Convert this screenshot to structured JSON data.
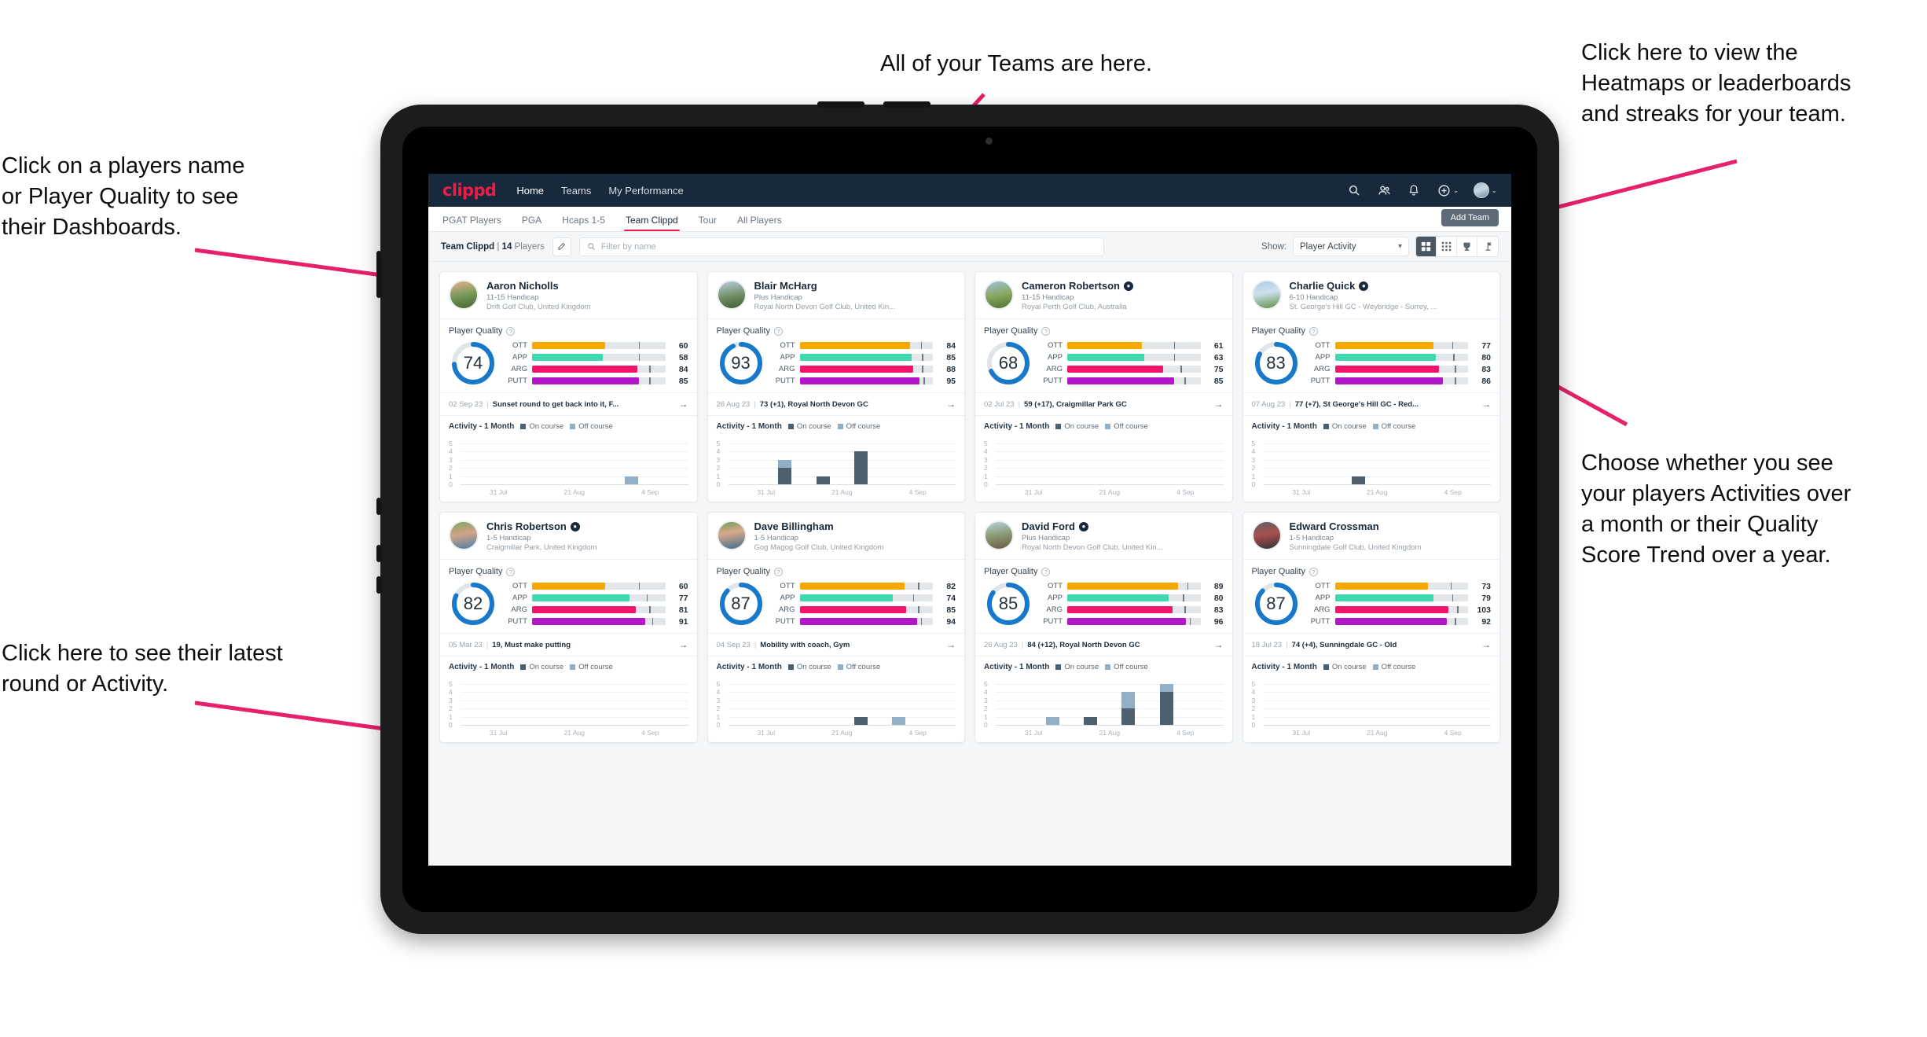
{
  "annotations": {
    "players": "Click on a players name\nor Player Quality to see\ntheir Dashboards.",
    "latest": "Click here to see their latest\nround or Activity.",
    "teams": "All of your Teams are here.",
    "heatmaps": "Click here to view the\nHeatmaps or leaderboards\nand streaks for your team.",
    "choose": "Choose whether you see\nyour players Activities over\na month or their Quality\nScore Trend over a year."
  },
  "topnav": {
    "logo": "clippd",
    "links": [
      {
        "label": "Home",
        "active": true
      },
      {
        "label": "Teams",
        "active": false
      },
      {
        "label": "My Performance",
        "active": false
      }
    ],
    "icons": [
      "search-icon",
      "people-icon",
      "bell-icon",
      "plus-circle-icon"
    ],
    "add_caret": "⌄",
    "avatar_caret": "⌄"
  },
  "subnav": {
    "tabs": [
      {
        "label": "PGAT Players",
        "active": false
      },
      {
        "label": "PGA",
        "active": false
      },
      {
        "label": "Hcaps 1-5",
        "active": false
      },
      {
        "label": "Team Clippd",
        "active": true
      },
      {
        "label": "Tour",
        "active": false
      },
      {
        "label": "All Players",
        "active": false
      }
    ],
    "add_team_label": "Add Team"
  },
  "toolbar": {
    "team_name": "Team Clippd",
    "separator": "|",
    "player_count": "14",
    "players_word": "Players",
    "edit_icon": "pencil-icon",
    "search_placeholder": "Filter by name",
    "show_label": "Show:",
    "show_value": "Player Activity",
    "view_buttons": [
      {
        "name": "grid-view-button",
        "glyph": "grid-large-icon",
        "active": true
      },
      {
        "name": "dense-grid-view-button",
        "glyph": "grid-dense-icon",
        "active": false
      },
      {
        "name": "heatmap-view-button",
        "glyph": "trophy-icon",
        "active": false
      },
      {
        "name": "leaderboard-view-button",
        "glyph": "flag-icon",
        "active": false
      }
    ]
  },
  "labels": {
    "player_quality": "Player Quality",
    "activity_title": "Activity - 1 Month",
    "legend_on": "On course",
    "legend_off": "Off course",
    "arrow": "→",
    "help": "?"
  },
  "colors": {
    "brand_pink": "#ec1c4b",
    "nav_dark": "#17293a",
    "ring_blue": "#1878c9",
    "ott": "#f5a800",
    "app": "#3fd8b1",
    "arg": "#f2156b",
    "putt": "#b117c4",
    "on_course": "#4e5f6d",
    "off_course": "#92afc6"
  },
  "chart_data": {
    "type": "bar",
    "title": "Activity - 1 Month",
    "ylabel": "",
    "xlabel": "",
    "ylim": [
      0,
      5
    ],
    "yticks": [
      5,
      4,
      3,
      2,
      1,
      0
    ],
    "xticks": [
      "31 Jul",
      "21 Aug",
      "4 Sep"
    ],
    "legend": [
      "On course",
      "Off course"
    ],
    "stacked": true
  },
  "players": [
    {
      "name": "Aaron Nicholls",
      "verified": false,
      "avatar_class": "av0",
      "handicap": "11-15 Handicap",
      "club": "Drift Golf Club, United Kingdom",
      "quality": 74,
      "metrics": [
        {
          "label": "OTT",
          "value": 60,
          "fill_pct": 55,
          "tick_pct": 80,
          "color": "#f5a800"
        },
        {
          "label": "APP",
          "value": 58,
          "fill_pct": 53,
          "tick_pct": 80,
          "color": "#3fd8b1"
        },
        {
          "label": "ARG",
          "value": 84,
          "fill_pct": 79,
          "tick_pct": 88,
          "color": "#f2156b"
        },
        {
          "label": "PUTT",
          "value": 85,
          "fill_pct": 80,
          "tick_pct": 88,
          "color": "#b117c4"
        }
      ],
      "round_date": "02 Sep 23",
      "round_text": "Sunset round to get back into it, F...",
      "activity": [
        {
          "on": 0,
          "off": 0
        },
        {
          "on": 0,
          "off": 0
        },
        {
          "on": 0,
          "off": 0
        },
        {
          "on": 0,
          "off": 0
        },
        {
          "on": 0,
          "off": 1
        },
        {
          "on": 0,
          "off": 0
        }
      ]
    },
    {
      "name": "Blair McHarg",
      "verified": false,
      "avatar_class": "av1",
      "handicap": "Plus Handicap",
      "club": "Royal North Devon Golf Club, United Kin...",
      "quality": 93,
      "metrics": [
        {
          "label": "OTT",
          "value": 84,
          "fill_pct": 83,
          "tick_pct": 91,
          "color": "#f5a800"
        },
        {
          "label": "APP",
          "value": 85,
          "fill_pct": 84,
          "tick_pct": 92,
          "color": "#3fd8b1"
        },
        {
          "label": "ARG",
          "value": 88,
          "fill_pct": 85,
          "tick_pct": 92,
          "color": "#f2156b"
        },
        {
          "label": "PUTT",
          "value": 95,
          "fill_pct": 90,
          "tick_pct": 93,
          "color": "#b117c4"
        }
      ],
      "round_date": "26 Aug 23",
      "round_text": "73 (+1), Royal North Devon GC",
      "activity": [
        {
          "on": 0,
          "off": 0
        },
        {
          "on": 2,
          "off": 1
        },
        {
          "on": 1,
          "off": 0
        },
        {
          "on": 4,
          "off": 0
        },
        {
          "on": 0,
          "off": 0
        },
        {
          "on": 0,
          "off": 0
        }
      ]
    },
    {
      "name": "Cameron Robertson",
      "verified": true,
      "avatar_class": "av2",
      "handicap": "11-15 Handicap",
      "club": "Royal Perth Golf Club, Australia",
      "quality": 68,
      "metrics": [
        {
          "label": "OTT",
          "value": 61,
          "fill_pct": 56,
          "tick_pct": 80,
          "color": "#f5a800"
        },
        {
          "label": "APP",
          "value": 63,
          "fill_pct": 58,
          "tick_pct": 80,
          "color": "#3fd8b1"
        },
        {
          "label": "ARG",
          "value": 75,
          "fill_pct": 72,
          "tick_pct": 85,
          "color": "#f2156b"
        },
        {
          "label": "PUTT",
          "value": 85,
          "fill_pct": 80,
          "tick_pct": 88,
          "color": "#b117c4"
        }
      ],
      "round_date": "02 Jul 23",
      "round_text": "59 (+17), Craigmillar Park GC",
      "activity": [
        {
          "on": 0,
          "off": 0
        },
        {
          "on": 0,
          "off": 0
        },
        {
          "on": 0,
          "off": 0
        },
        {
          "on": 0,
          "off": 0
        },
        {
          "on": 0,
          "off": 0
        },
        {
          "on": 0,
          "off": 0
        }
      ]
    },
    {
      "name": "Charlie Quick",
      "verified": true,
      "avatar_class": "av3",
      "handicap": "6-10 Handicap",
      "club": "St. George's Hill GC - Weybridge - Surrey, ...",
      "quality": 83,
      "metrics": [
        {
          "label": "OTT",
          "value": 77,
          "fill_pct": 74,
          "tick_pct": 88,
          "color": "#f5a800"
        },
        {
          "label": "APP",
          "value": 80,
          "fill_pct": 76,
          "tick_pct": 89,
          "color": "#3fd8b1"
        },
        {
          "label": "ARG",
          "value": 83,
          "fill_pct": 78,
          "tick_pct": 90,
          "color": "#f2156b"
        },
        {
          "label": "PUTT",
          "value": 86,
          "fill_pct": 81,
          "tick_pct": 90,
          "color": "#b117c4"
        }
      ],
      "round_date": "07 Aug 23",
      "round_text": "77 (+7), St George's Hill GC - Red...",
      "activity": [
        {
          "on": 0,
          "off": 0
        },
        {
          "on": 0,
          "off": 0
        },
        {
          "on": 1,
          "off": 0
        },
        {
          "on": 0,
          "off": 0
        },
        {
          "on": 0,
          "off": 0
        },
        {
          "on": 0,
          "off": 0
        }
      ]
    },
    {
      "name": "Chris Robertson",
      "verified": true,
      "avatar_class": "av4",
      "handicap": "1-5 Handicap",
      "club": "Craigmillar Park, United Kingdom",
      "quality": 82,
      "metrics": [
        {
          "label": "OTT",
          "value": 60,
          "fill_pct": 55,
          "tick_pct": 80,
          "color": "#f5a800"
        },
        {
          "label": "APP",
          "value": 77,
          "fill_pct": 73,
          "tick_pct": 86,
          "color": "#3fd8b1"
        },
        {
          "label": "ARG",
          "value": 81,
          "fill_pct": 78,
          "tick_pct": 88,
          "color": "#f2156b"
        },
        {
          "label": "PUTT",
          "value": 91,
          "fill_pct": 85,
          "tick_pct": 90,
          "color": "#b117c4"
        }
      ],
      "round_date": "05 Mar 23",
      "round_text": "19, Must make putting",
      "activity": [
        {
          "on": 0,
          "off": 0
        },
        {
          "on": 0,
          "off": 0
        },
        {
          "on": 0,
          "off": 0
        },
        {
          "on": 0,
          "off": 0
        },
        {
          "on": 0,
          "off": 0
        },
        {
          "on": 0,
          "off": 0
        }
      ]
    },
    {
      "name": "Dave Billingham",
      "verified": false,
      "avatar_class": "av5",
      "handicap": "1-5 Handicap",
      "club": "Gog Magog Golf Club, United Kingdom",
      "quality": 87,
      "metrics": [
        {
          "label": "OTT",
          "value": 82,
          "fill_pct": 79,
          "tick_pct": 89,
          "color": "#f5a800"
        },
        {
          "label": "APP",
          "value": 74,
          "fill_pct": 70,
          "tick_pct": 85,
          "color": "#3fd8b1"
        },
        {
          "label": "ARG",
          "value": 85,
          "fill_pct": 80,
          "tick_pct": 89,
          "color": "#f2156b"
        },
        {
          "label": "PUTT",
          "value": 94,
          "fill_pct": 88,
          "tick_pct": 91,
          "color": "#b117c4"
        }
      ],
      "round_date": "04 Sep 23",
      "round_text": "Mobility with coach, Gym",
      "activity": [
        {
          "on": 0,
          "off": 0
        },
        {
          "on": 0,
          "off": 0
        },
        {
          "on": 0,
          "off": 0
        },
        {
          "on": 1,
          "off": 0
        },
        {
          "on": 0,
          "off": 1
        },
        {
          "on": 0,
          "off": 0
        }
      ]
    },
    {
      "name": "David Ford",
      "verified": true,
      "avatar_class": "av6",
      "handicap": "Plus Handicap",
      "club": "Royal North Devon Golf Club, United Kin...",
      "quality": 85,
      "metrics": [
        {
          "label": "OTT",
          "value": 89,
          "fill_pct": 83,
          "tick_pct": 90,
          "color": "#f5a800"
        },
        {
          "label": "APP",
          "value": 80,
          "fill_pct": 76,
          "tick_pct": 87,
          "color": "#3fd8b1"
        },
        {
          "label": "ARG",
          "value": 83,
          "fill_pct": 79,
          "tick_pct": 88,
          "color": "#f2156b"
        },
        {
          "label": "PUTT",
          "value": 96,
          "fill_pct": 89,
          "tick_pct": 92,
          "color": "#b117c4"
        }
      ],
      "round_date": "26 Aug 23",
      "round_text": "84 (+12), Royal North Devon GC",
      "activity": [
        {
          "on": 0,
          "off": 0
        },
        {
          "on": 0,
          "off": 1
        },
        {
          "on": 1,
          "off": 0
        },
        {
          "on": 2,
          "off": 2
        },
        {
          "on": 4,
          "off": 1
        },
        {
          "on": 0,
          "off": 0
        }
      ]
    },
    {
      "name": "Edward Crossman",
      "verified": false,
      "avatar_class": "av7",
      "handicap": "1-5 Handicap",
      "club": "Sunningdale Golf Club, United Kingdom",
      "quality": 87,
      "metrics": [
        {
          "label": "OTT",
          "value": 73,
          "fill_pct": 70,
          "tick_pct": 87,
          "color": "#f5a800"
        },
        {
          "label": "APP",
          "value": 79,
          "fill_pct": 74,
          "tick_pct": 88,
          "color": "#3fd8b1"
        },
        {
          "label": "ARG",
          "value": 103,
          "fill_pct": 85,
          "tick_pct": 92,
          "color": "#f2156b"
        },
        {
          "label": "PUTT",
          "value": 92,
          "fill_pct": 84,
          "tick_pct": 90,
          "color": "#b117c4"
        }
      ],
      "round_date": "18 Jul 23",
      "round_text": "74 (+4), Sunningdale GC - Old",
      "activity": [
        {
          "on": 0,
          "off": 0
        },
        {
          "on": 0,
          "off": 0
        },
        {
          "on": 0,
          "off": 0
        },
        {
          "on": 0,
          "off": 0
        },
        {
          "on": 0,
          "off": 0
        },
        {
          "on": 0,
          "off": 0
        }
      ]
    }
  ]
}
